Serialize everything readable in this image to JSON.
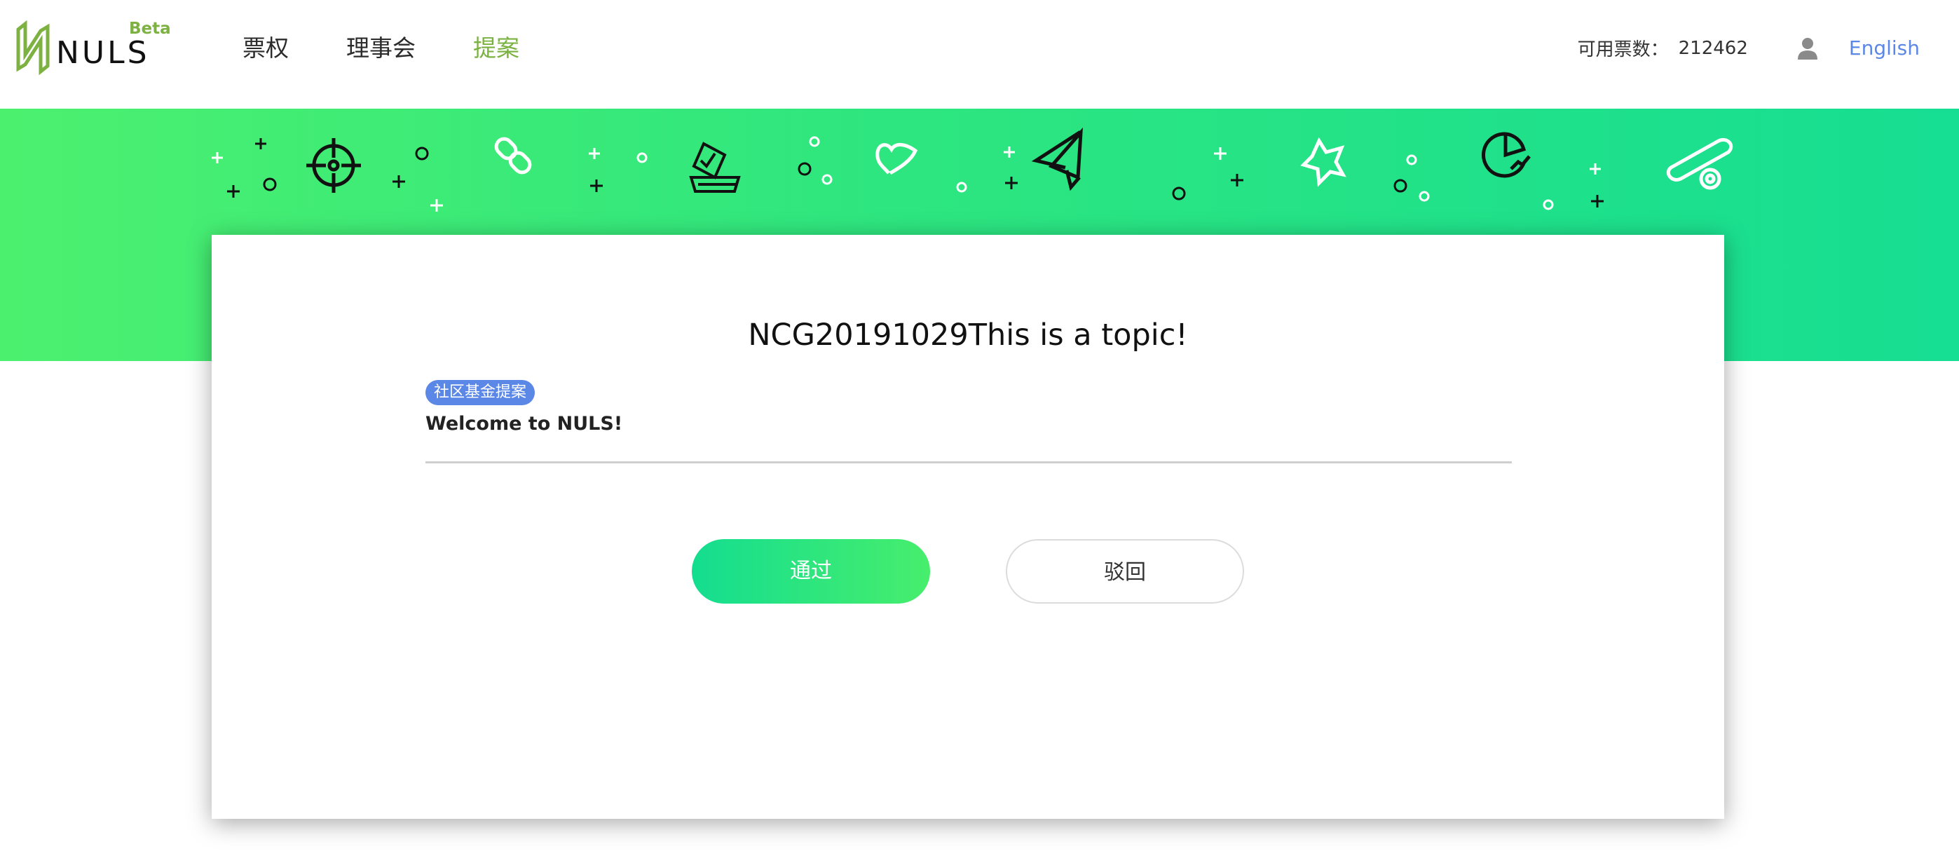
{
  "brand": {
    "logo_text": "NULS",
    "beta_label": "Beta",
    "accent_color": "#7ab241"
  },
  "nav": {
    "items": [
      {
        "label": "票权",
        "active": false
      },
      {
        "label": "理事会",
        "active": false
      },
      {
        "label": "提案",
        "active": true
      }
    ]
  },
  "account": {
    "votes_label": "可用票数：",
    "votes_value": "212462",
    "user_icon": "user-icon",
    "language_link": "English",
    "link_color": "#5b87e6"
  },
  "banner": {
    "gradient_start": "#4cf06f",
    "gradient_end": "#16de92",
    "decor_icons": [
      "crosshair-icon",
      "link-icon",
      "ballot-box-icon",
      "heart-icon",
      "paper-plane-icon",
      "star-icon",
      "pie-chart-icon",
      "coin-icon"
    ]
  },
  "proposal": {
    "title": "NCG20191029This is a topic!",
    "category_badge": "社区基金提案",
    "category_color": "#5b87e6",
    "description": "Welcome to NULS!",
    "approve_label": "通过",
    "reject_label": "驳回"
  }
}
